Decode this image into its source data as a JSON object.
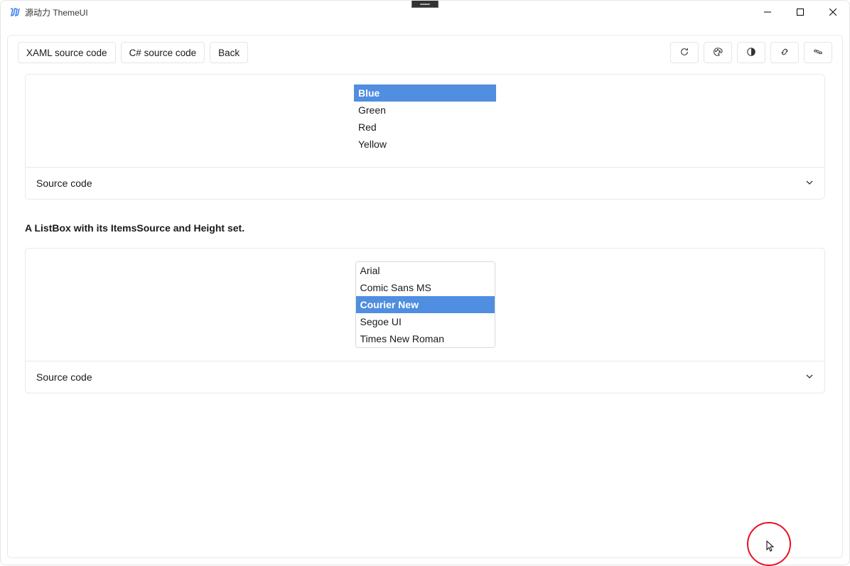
{
  "window": {
    "title": "源动力 ThemeUI"
  },
  "toolbar": {
    "xaml": "XAML source code",
    "csharp": "C# source code",
    "back": "Back"
  },
  "icons": {
    "refresh": "refresh",
    "palette": "palette",
    "contrast": "contrast",
    "link": "link",
    "chain": "chain"
  },
  "card1": {
    "items": [
      "Blue",
      "Green",
      "Red",
      "Yellow"
    ],
    "selectedIndex": 0,
    "expander": "Source code"
  },
  "section2": {
    "heading": "A ListBox with its ItemsSource and Height set."
  },
  "card2": {
    "items": [
      "Arial",
      "Comic Sans MS",
      "Courier New",
      "Segoe UI",
      "Times New Roman"
    ],
    "selectedIndex": 2,
    "expander": "Source code"
  }
}
